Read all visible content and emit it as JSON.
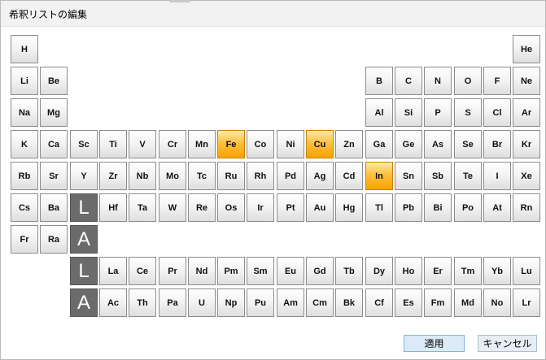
{
  "window": {
    "title": "希釈リストの編集"
  },
  "rows": [
    [
      "H",
      null,
      null,
      null,
      null,
      null,
      null,
      null,
      null,
      null,
      null,
      null,
      null,
      null,
      null,
      null,
      null,
      "He"
    ],
    [
      "Li",
      "Be",
      null,
      null,
      null,
      null,
      null,
      null,
      null,
      null,
      null,
      null,
      "B",
      "C",
      "N",
      "O",
      "F",
      "Ne"
    ],
    [
      "Na",
      "Mg",
      null,
      null,
      null,
      null,
      null,
      null,
      null,
      null,
      null,
      null,
      "Al",
      "Si",
      "P",
      "S",
      "Cl",
      "Ar"
    ],
    [
      "K",
      "Ca",
      "Sc",
      "Ti",
      "V",
      "Cr",
      "Mn",
      "Fe",
      "Co",
      "Ni",
      "Cu",
      "Zn",
      "Ga",
      "Ge",
      "As",
      "Se",
      "Br",
      "Kr"
    ],
    [
      "Rb",
      "Sr",
      "Y",
      "Zr",
      "Nb",
      "Mo",
      "Tc",
      "Ru",
      "Rh",
      "Pd",
      "Ag",
      "Cd",
      "In",
      "Sn",
      "Sb",
      "Te",
      "I",
      "Xe"
    ],
    [
      "Cs",
      "Ba",
      "#L",
      "Hf",
      "Ta",
      "W",
      "Re",
      "Os",
      "Ir",
      "Pt",
      "Au",
      "Hg",
      "Tl",
      "Pb",
      "Bi",
      "Po",
      "At",
      "Rn"
    ],
    [
      "Fr",
      "Ra",
      "#A",
      null,
      null,
      null,
      null,
      null,
      null,
      null,
      null,
      null,
      null,
      null,
      null,
      null,
      null,
      null
    ],
    [
      null,
      null,
      "#L",
      "La",
      "Ce",
      "Pr",
      "Nd",
      "Pm",
      "Sm",
      "Eu",
      "Gd",
      "Tb",
      "Dy",
      "Ho",
      "Er",
      "Tm",
      "Yb",
      "Lu"
    ],
    [
      null,
      null,
      "#A",
      "Ac",
      "Th",
      "Pa",
      "U",
      "Np",
      "Pu",
      "Am",
      "Cm",
      "Bk",
      "Cf",
      "Es",
      "Fm",
      "Md",
      "No",
      "Lr"
    ]
  ],
  "selected": [
    "Fe",
    "Cu",
    "In"
  ],
  "placeholders": {
    "L": "L",
    "A": "A"
  },
  "buttons": {
    "apply": "適用",
    "cancel": "キャンセル"
  }
}
